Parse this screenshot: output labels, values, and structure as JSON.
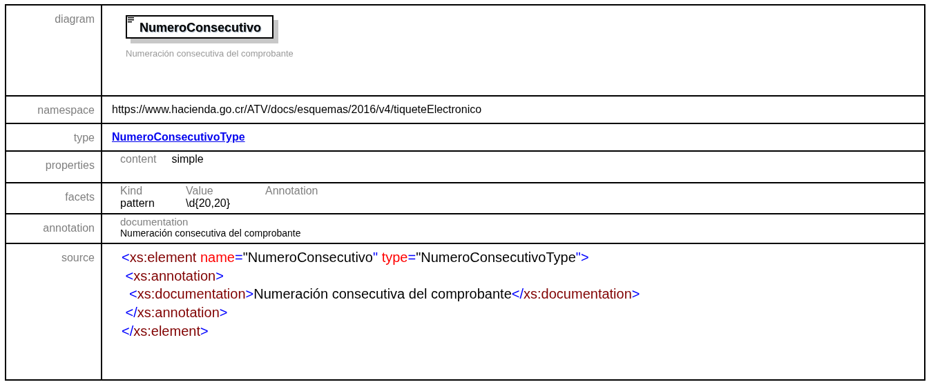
{
  "rows": [
    {
      "kind": "diagram",
      "label": "diagram",
      "element_name": "NumeroConsecutivo",
      "caption": "Numeración consecutiva del comprobante"
    },
    {
      "kind": "text",
      "label": "namespace",
      "value": "https://www.hacienda.go.cr/ATV/docs/esquemas/2016/v4/tiqueteElectronico"
    },
    {
      "kind": "link",
      "label": "type",
      "value": "NumeroConsecutivoType"
    },
    {
      "kind": "properties",
      "label": "properties",
      "pairs": [
        {
          "name": "content",
          "value": "simple"
        }
      ]
    },
    {
      "kind": "facets",
      "label": "facets",
      "columns": [
        "Kind",
        "Value",
        "Annotation"
      ],
      "rows": [
        {
          "kind": "pattern",
          "value": "\\d{20,20}"
        }
      ]
    },
    {
      "kind": "annotation",
      "label": "annotation",
      "heading": "documentation",
      "value": "Numeración consecutiva del comprobante"
    },
    {
      "kind": "source",
      "label": "source",
      "lines": [
        [
          {
            "t": "<",
            "kind": "punct"
          },
          {
            "t": "xs:element",
            "kind": "tag"
          },
          {
            "t": " name",
            "kind": "attr"
          },
          {
            "t": "=",
            "kind": "punct"
          },
          {
            "t": "\"NumeroConsecutivo",
            "kind": "text"
          },
          {
            "t": "\"",
            "kind": "punct"
          },
          {
            "t": " type",
            "kind": "attr"
          },
          {
            "t": "=",
            "kind": "punct"
          },
          {
            "t": "\"NumeroConsecutivoType",
            "kind": "text"
          },
          {
            "t": "\">",
            "kind": "punct"
          }
        ],
        [
          {
            "t": " <",
            "kind": "punct"
          },
          {
            "t": "xs:annotation",
            "kind": "tag"
          },
          {
            "t": ">",
            "kind": "punct"
          }
        ],
        [
          {
            "t": "  <",
            "kind": "punct"
          },
          {
            "t": "xs:documentation",
            "kind": "tag"
          },
          {
            "t": ">",
            "kind": "punct"
          },
          {
            "t": "Numeración consecutiva del comprobante",
            "kind": "text"
          },
          {
            "t": "</",
            "kind": "punct"
          },
          {
            "t": "xs:documentation",
            "kind": "tag"
          },
          {
            "t": ">",
            "kind": "punct"
          }
        ],
        [
          {
            "t": " </",
            "kind": "punct"
          },
          {
            "t": "xs:annotation",
            "kind": "tag"
          },
          {
            "t": ">",
            "kind": "punct"
          }
        ],
        [
          {
            "t": "</",
            "kind": "punct"
          },
          {
            "t": "xs:element",
            "kind": "tag"
          },
          {
            "t": ">",
            "kind": "punct"
          }
        ]
      ]
    }
  ]
}
